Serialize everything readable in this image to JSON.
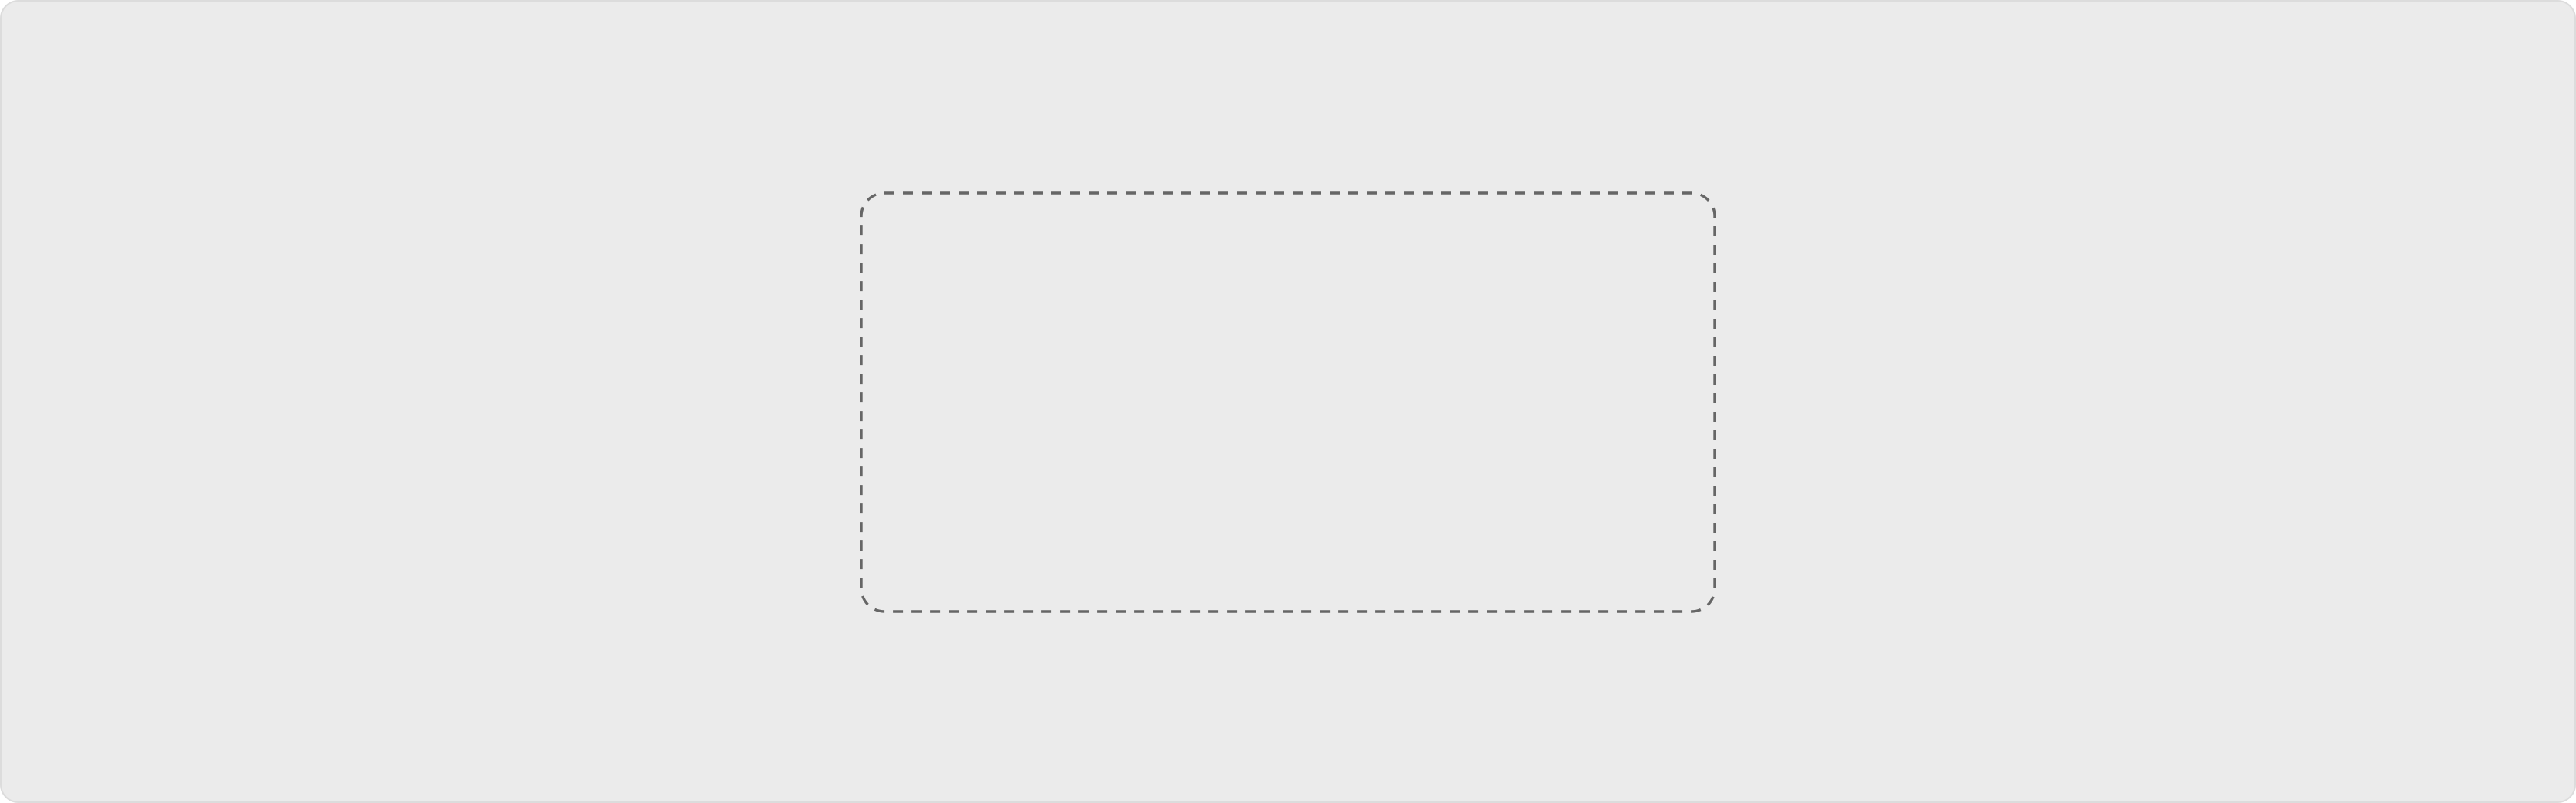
{
  "colors": {
    "background": "#ebebeb",
    "outer_border": "#dcdcdc",
    "dropzone_border": "#666666"
  },
  "dropzone": {
    "label": ""
  }
}
